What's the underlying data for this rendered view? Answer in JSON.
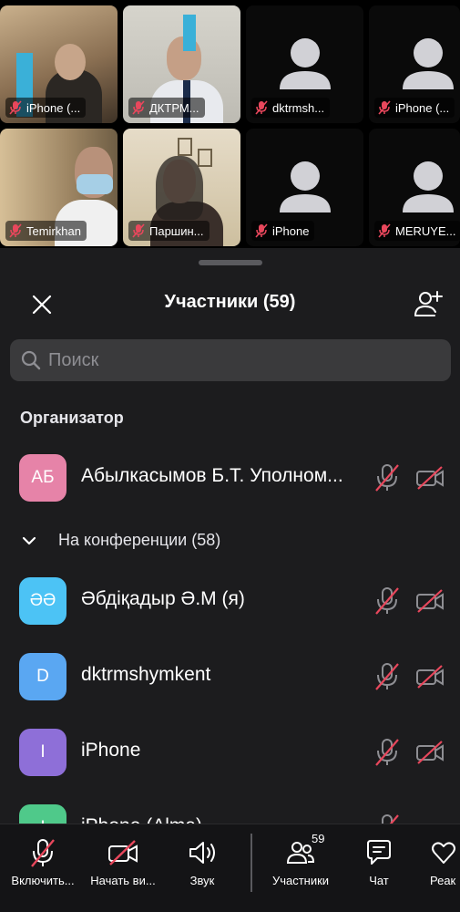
{
  "video_tiles": [
    {
      "name": "iPhone (...",
      "type": "video",
      "bg": "#a58a6e"
    },
    {
      "name": "ДКТРМ...",
      "type": "video",
      "bg": "#c8c8c0"
    },
    {
      "name": "dktrmsh...",
      "type": "avatar"
    },
    {
      "name": "iPhone (...",
      "type": "avatar"
    },
    {
      "name": "Temirkhan",
      "type": "video",
      "bg": "#a89574"
    },
    {
      "name": "Паршин...",
      "type": "video",
      "bg": "#b9a68a"
    },
    {
      "name": "iPhone",
      "type": "avatar"
    },
    {
      "name": "MERUYE...",
      "type": "avatar"
    }
  ],
  "sheet": {
    "title": "Участники (59)",
    "search_placeholder": "Поиск",
    "organizer_label": "Организатор",
    "conference_label": "На конференции (58)"
  },
  "organizer": {
    "initials": "АБ",
    "name": "Абылкасымов Б.Т. Уполном...",
    "color": "#e683a8"
  },
  "participants": [
    {
      "initials": "ӘӘ",
      "name": "Әбдіқадыр Ә.М (я)",
      "color": "#4cc3f5"
    },
    {
      "initials": "D",
      "name": "dktrmshymkent",
      "color": "#5aa7f2"
    },
    {
      "initials": "I",
      "name": "iPhone",
      "color": "#8e6fd8"
    },
    {
      "initials": "I",
      "name": "iPhone (Alma)",
      "color": "#4fc98a"
    }
  ],
  "toolbar": {
    "mic_label": "Включить...",
    "video_label": "Начать ви...",
    "audio_label": "Звук",
    "participants_label": "Участники",
    "participants_count": "59",
    "chat_label": "Чат",
    "react_label": "Реак"
  },
  "colors": {
    "mic_off": "#e8475c",
    "icon_gray": "#8e8e93"
  }
}
